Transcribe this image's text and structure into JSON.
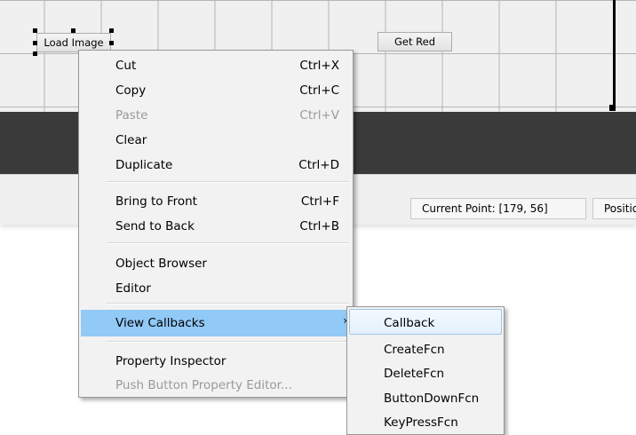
{
  "canvas": {
    "buttons": [
      {
        "label": "Load Image"
      },
      {
        "label": "Get Red"
      }
    ]
  },
  "status_bar": {
    "current_point": "Current Point:  [179, 56]",
    "position": "Position"
  },
  "context_menu": {
    "items": [
      {
        "label": "Cut",
        "shortcut": "Ctrl+X"
      },
      {
        "label": "Copy",
        "shortcut": "Ctrl+C"
      },
      {
        "label": "Paste",
        "shortcut": "Ctrl+V",
        "disabled": true
      },
      {
        "label": "Clear",
        "shortcut": ""
      },
      {
        "label": "Duplicate",
        "shortcut": "Ctrl+D"
      },
      {
        "label": "Bring to Front",
        "shortcut": "Ctrl+F"
      },
      {
        "label": "Send to Back",
        "shortcut": "Ctrl+B"
      },
      {
        "label": "Object Browser",
        "shortcut": ""
      },
      {
        "label": "Editor",
        "shortcut": ""
      },
      {
        "label": "View Callbacks",
        "shortcut": "",
        "submenu": true,
        "highlighted": true
      },
      {
        "label": "Property Inspector",
        "shortcut": ""
      },
      {
        "label": "Push Button Property Editor...",
        "shortcut": "",
        "disabled": true
      }
    ],
    "submenu_arrow_icon": "chevron-right-icon"
  },
  "submenu": {
    "items": [
      {
        "label": "Callback",
        "selected": true
      },
      {
        "label": "CreateFcn"
      },
      {
        "label": "DeleteFcn"
      },
      {
        "label": "ButtonDownFcn"
      },
      {
        "label": "KeyPressFcn"
      }
    ]
  },
  "colors": {
    "highlight": "#91c9f7",
    "dark_band": "#3a3a3a",
    "menu_bg": "#f2f2f2",
    "selected_border": "#9cc6ec"
  }
}
